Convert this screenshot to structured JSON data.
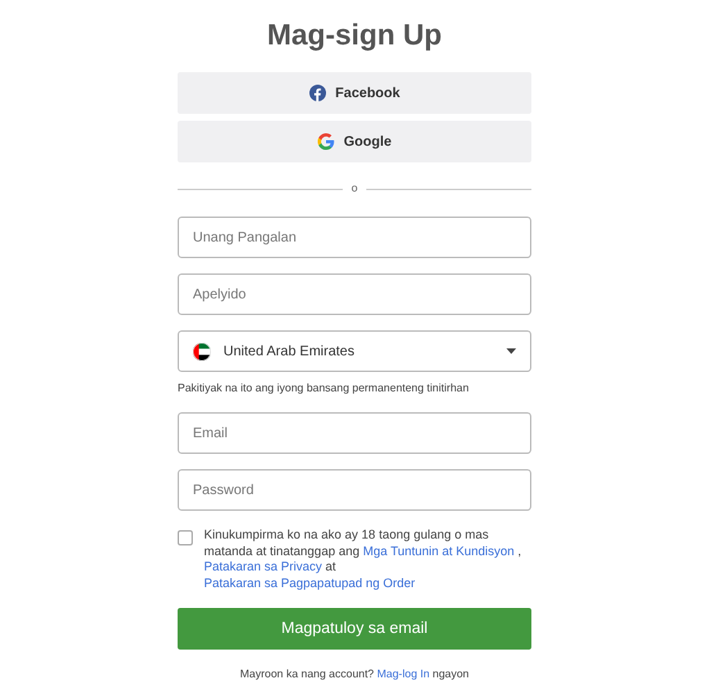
{
  "title": "Mag-sign Up",
  "social_buttons": [
    {
      "kind": "facebook",
      "label": "Facebook"
    },
    {
      "kind": "google",
      "label": "Google"
    }
  ],
  "divider_text": "o",
  "fields": [
    {
      "kind": "input",
      "placeholder": "Unang Pangalan"
    },
    {
      "kind": "input",
      "placeholder": "Apelyido"
    },
    {
      "kind": "select",
      "value": "United Arab Emirates",
      "hint": "Pakitiyak na ito ang iyong bansang permanenteng tinitirhan"
    },
    {
      "kind": "input",
      "placeholder": "Email"
    },
    {
      "kind": "password",
      "placeholder": "Password"
    }
  ],
  "consent": {
    "checked": false,
    "segments": [
      {
        "kind": "text",
        "text": "Kinukumpirma ko na ako ay 18 taong gulang o mas matanda at tinatanggap ang "
      },
      {
        "kind": "link",
        "text": "Mga Tuntunin at Kundisyon"
      },
      {
        "kind": "text",
        "text": " , "
      },
      {
        "kind": "link",
        "text": "Patakaran sa Privacy"
      },
      {
        "kind": "text",
        "text": " at "
      },
      {
        "kind": "link",
        "text": "Patakaran sa Pagpapatupad ng Order"
      }
    ]
  },
  "submit_button": "Magpatuloy sa email",
  "footer": {
    "before": "Mayroon ka nang account?",
    "link": "Mag-log In",
    "after": "ngayon"
  }
}
